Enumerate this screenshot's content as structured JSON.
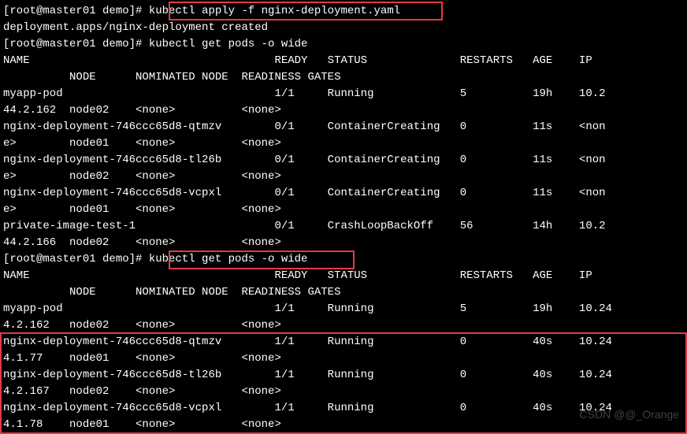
{
  "prompt": "[root@master01 demo]#",
  "cmd1": "kubectl apply -f nginx-deployment.yaml",
  "apply_output": "deployment.apps/nginx-deployment created",
  "cmd2": "kubectl get pods -o wide",
  "header": {
    "name": "NAME",
    "ready": "READY",
    "status": "STATUS",
    "restarts": "RESTARTS",
    "age": "AGE",
    "ip": "IP",
    "node": "NODE",
    "nominated": "NOMINATED NODE",
    "gates": "READINESS GATES"
  },
  "run1": {
    "rows": [
      {
        "name": "myapp-pod",
        "ready": "1/1",
        "status": "Running",
        "restarts": "5",
        "age": "19h",
        "ip": "10.2",
        "ip2": "44.2.162",
        "node": "node02",
        "nominated": "<none>",
        "gates": "<none>"
      },
      {
        "name": "nginx-deployment-746ccc65d8-qtmzv",
        "ready": "0/1",
        "status": "ContainerCreating",
        "restarts": "0",
        "age": "11s",
        "ip": "<non",
        "ip2": "e>",
        "node": "node01",
        "nominated": "<none>",
        "gates": "<none>"
      },
      {
        "name": "nginx-deployment-746ccc65d8-tl26b",
        "ready": "0/1",
        "status": "ContainerCreating",
        "restarts": "0",
        "age": "11s",
        "ip": "<non",
        "ip2": "e>",
        "node": "node02",
        "nominated": "<none>",
        "gates": "<none>"
      },
      {
        "name": "nginx-deployment-746ccc65d8-vcpxl",
        "ready": "0/1",
        "status": "ContainerCreating",
        "restarts": "0",
        "age": "11s",
        "ip": "<non",
        "ip2": "e>",
        "node": "node01",
        "nominated": "<none>",
        "gates": "<none>"
      },
      {
        "name": "private-image-test-1",
        "ready": "0/1",
        "status": "CrashLoopBackOff",
        "restarts": "56",
        "age": "14h",
        "ip": "10.2",
        "ip2": "44.2.166",
        "node": "node02",
        "nominated": "<none>",
        "gates": "<none>"
      }
    ]
  },
  "cmd3": "kubectl get pods -o wide",
  "run2": {
    "rows": [
      {
        "name": "myapp-pod",
        "ready": "1/1",
        "status": "Running",
        "restarts": "5",
        "age": "19h",
        "ip": "10.24",
        "ip2": "4.2.162",
        "node": "node02",
        "nominated": "<none>",
        "gates": "<none>"
      },
      {
        "name": "nginx-deployment-746ccc65d8-qtmzv",
        "ready": "1/1",
        "status": "Running",
        "restarts": "0",
        "age": "40s",
        "ip": "10.24",
        "ip2": "4.1.77",
        "node": "node01",
        "nominated": "<none>",
        "gates": "<none>"
      },
      {
        "name": "nginx-deployment-746ccc65d8-tl26b",
        "ready": "1/1",
        "status": "Running",
        "restarts": "0",
        "age": "40s",
        "ip": "10.24",
        "ip2": "4.2.167",
        "node": "node02",
        "nominated": "<none>",
        "gates": "<none>"
      },
      {
        "name": "nginx-deployment-746ccc65d8-vcpxl",
        "ready": "1/1",
        "status": "Running",
        "restarts": "0",
        "age": "40s",
        "ip": "10.24",
        "ip2": "4.1.78",
        "node": "node01",
        "nominated": "<none>",
        "gates": "<none>"
      }
    ]
  },
  "watermark": "CSDN @@_Orange"
}
